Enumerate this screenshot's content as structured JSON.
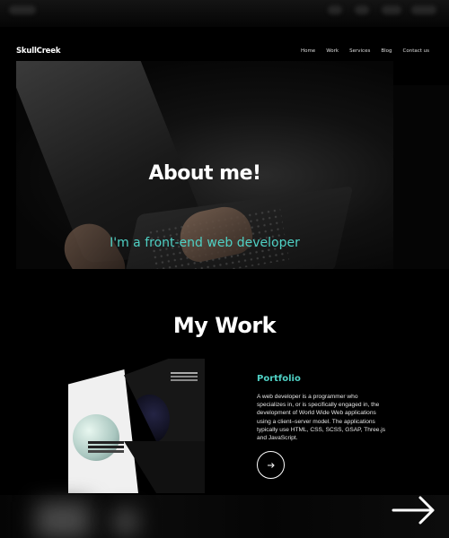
{
  "nav": {
    "logo": "SkullCreek",
    "links": [
      "Home",
      "Work",
      "Services",
      "Blog",
      "Contact us"
    ]
  },
  "hero": {
    "title": "About me!",
    "subtitle": "I'm a front-end web developer"
  },
  "work": {
    "section_title": "My Work",
    "project_title": "Portfolio",
    "project_description": "A web developer is a programmer who specializes in, or is specifically engaged in, the development of World Wide Web applications using a client–server model. The applications typically use HTML, CSS, SCSS, GSAP, Three.js and JavaScript.",
    "button_icon": "arrow-right-icon"
  },
  "next_icon": "long-arrow-right-icon",
  "colors": {
    "accent": "#4fd1c5",
    "background": "#000000",
    "text": "#ffffff"
  }
}
